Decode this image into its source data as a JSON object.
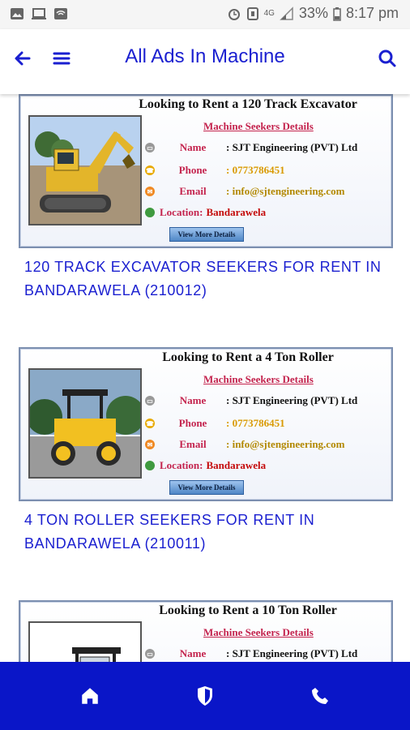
{
  "status_bar": {
    "battery": "33%",
    "time": "8:17 pm",
    "network": "4G"
  },
  "header": {
    "title": "All Ads In Machine"
  },
  "ads": [
    {
      "banner_heading": "Looking to Rent a 120 Track Excavator",
      "subheading": "Machine Seekers Details",
      "name_label": "Name",
      "name_value": ": SJT Engineering (PVT) Ltd",
      "phone_label": "Phone",
      "phone_value": ": 0773786451",
      "email_label": "Email",
      "email_value": ": info@sjtengineering.com",
      "location_label": "Location:",
      "location_value": "Bandarawela",
      "view_more": "View More Details",
      "title": "120 TRACK EXCAVATOR SEEKERS FOR RENT IN BANDARAWELA (210012)"
    },
    {
      "banner_heading": "Looking to Rent a 4 Ton Roller",
      "subheading": "Machine Seekers Details",
      "name_label": "Name",
      "name_value": ": SJT Engineering (PVT) Ltd",
      "phone_label": "Phone",
      "phone_value": ": 0773786451",
      "email_label": "Email",
      "email_value": ": info@sjtengineering.com",
      "location_label": "Location:",
      "location_value": "Bandarawela",
      "view_more": "View More Details",
      "title": "4 TON ROLLER SEEKERS FOR RENT IN BANDARAWELA (210011)"
    },
    {
      "banner_heading": "Looking to Rent a 10 Ton Roller",
      "subheading": "Machine Seekers Details",
      "name_label": "Name",
      "name_value": ": SJT Engineering (PVT) Ltd"
    }
  ],
  "colors": {
    "accent": "#1a1fd0",
    "nav_bg": "#0a16c8",
    "subhead": "#c4244e",
    "phone": "#d99a00",
    "location": "#c40a0a"
  },
  "icons": {
    "back": "arrow-left-icon",
    "menu": "hamburger-menu-icon",
    "search": "search-icon",
    "home": "home-icon",
    "shield": "shield-icon",
    "phone": "phone-icon"
  }
}
